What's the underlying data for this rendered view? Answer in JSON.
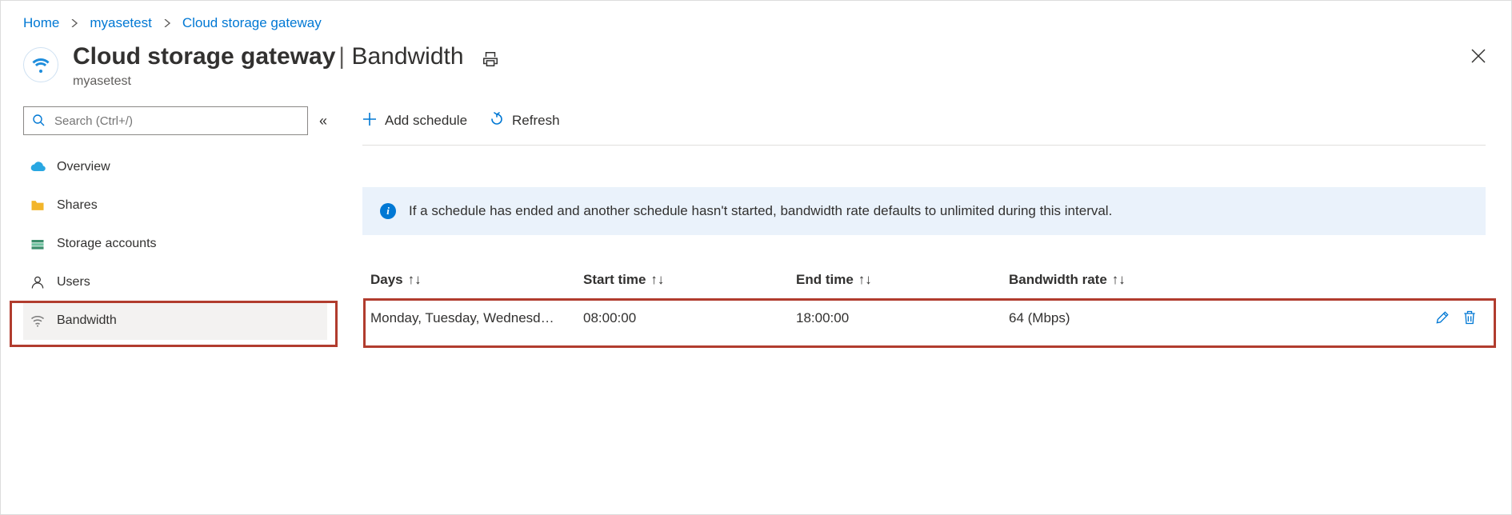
{
  "breadcrumb": {
    "items": [
      {
        "label": "Home"
      },
      {
        "label": "myasetest"
      },
      {
        "label": "Cloud storage gateway"
      }
    ]
  },
  "header": {
    "title": "Cloud storage gateway",
    "section": "Bandwidth",
    "resourceName": "myasetest"
  },
  "sidebar": {
    "searchPlaceholder": "Search (Ctrl+/)",
    "items": [
      {
        "icon": "cloud-icon",
        "label": "Overview"
      },
      {
        "icon": "folder-icon",
        "label": "Shares"
      },
      {
        "icon": "storage-icon",
        "label": "Storage accounts"
      },
      {
        "icon": "user-icon",
        "label": "Users"
      },
      {
        "icon": "wifi-icon",
        "label": "Bandwidth",
        "active": true
      }
    ]
  },
  "toolbar": {
    "add_label": "Add schedule",
    "refresh_label": "Refresh"
  },
  "info": {
    "text": "If a schedule has ended and another schedule hasn't started, bandwidth rate defaults to unlimited during this interval."
  },
  "table": {
    "columns": [
      "Days",
      "Start time",
      "End time",
      "Bandwidth rate"
    ],
    "rows": [
      {
        "days": "Monday, Tuesday, Wednesd…",
        "start": "08:00:00",
        "end": "18:00:00",
        "rate": "64 (Mbps)"
      }
    ]
  }
}
